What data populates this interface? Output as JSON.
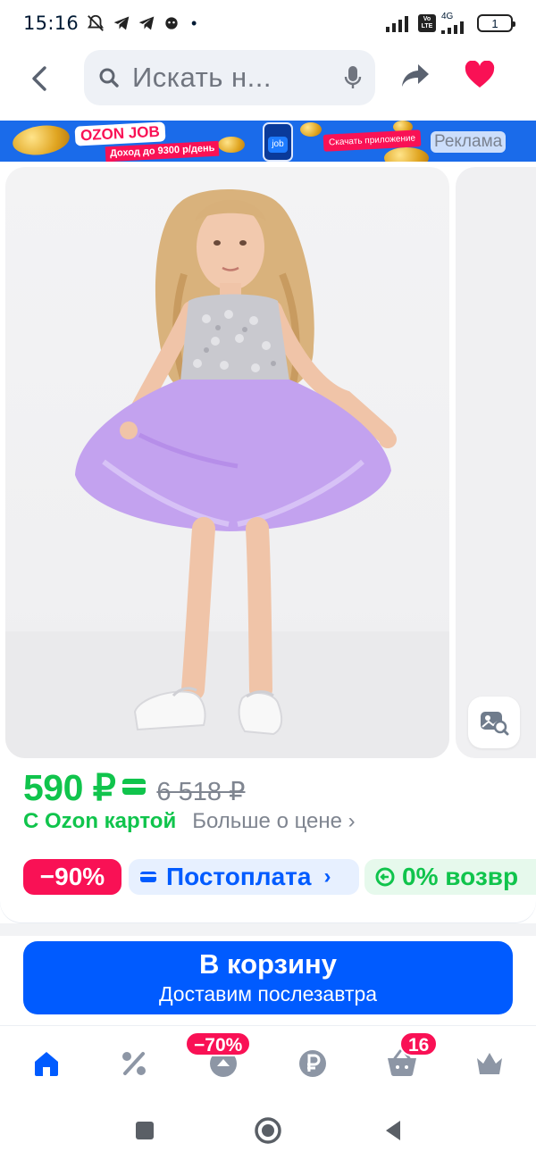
{
  "status_bar": {
    "time": "15:16",
    "network_label": "4G",
    "volte_label": "Vo LTE",
    "battery_level": "1"
  },
  "header": {
    "search_placeholder": "Искать н...",
    "icons": [
      "back-arrow-icon",
      "search-icon",
      "microphone-icon",
      "share-icon",
      "heart-icon"
    ]
  },
  "ad": {
    "brand": "OZON JOB",
    "subtitle": "Доход до 9300 р/день",
    "app_badge": "job",
    "cta": "Скачать приложение",
    "label": "Реклама"
  },
  "product": {
    "price": "590 ₽",
    "old_price": "6 518 ₽",
    "card_note": "С Ozon картой",
    "more_price": "Больше о цене ›",
    "chips": {
      "discount": "−90%",
      "postpay": "Постоплата",
      "postpay_arrow": "›",
      "return": "0% возвр"
    }
  },
  "cart_button": {
    "title": "В корзину",
    "subtitle": "Доставим послезавтра"
  },
  "tabbar": {
    "tabs": [
      "home-icon",
      "percent-icon",
      "fresh-icon",
      "ruble-icon",
      "cart-icon",
      "crown-icon"
    ],
    "promo_badge": "−70%",
    "cart_badge": "16"
  },
  "colors": {
    "brand_blue": "#005bff",
    "price_green": "#10c44c",
    "accent_pink": "#f91155",
    "heart_red": "#f91155"
  }
}
